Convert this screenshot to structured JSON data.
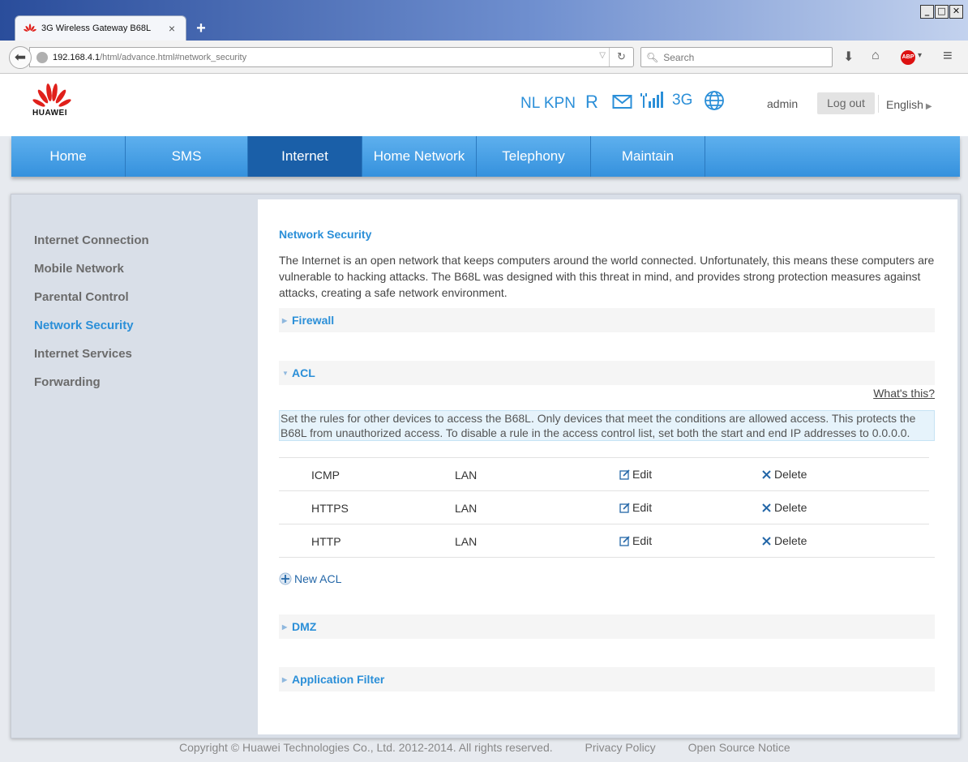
{
  "browser": {
    "tab_title": "3G Wireless Gateway B68L",
    "tab_close": "×",
    "new_tab": "+",
    "url_host": "192.168.4.1",
    "url_path": "/html/advance.html#network_security",
    "search_placeholder": "Search",
    "window_buttons": [
      "_",
      "□",
      "✕"
    ]
  },
  "header": {
    "brand": "HUAWEI",
    "operator": "NL KPN",
    "roaming": "R",
    "network_type": "3G",
    "user": "admin",
    "logout_label": "Log out",
    "language": "English"
  },
  "menu": [
    {
      "label": "Home",
      "active": false
    },
    {
      "label": "SMS",
      "active": false
    },
    {
      "label": "Internet",
      "active": true
    },
    {
      "label": "Home Network",
      "active": false
    },
    {
      "label": "Telephony",
      "active": false
    },
    {
      "label": "Maintain",
      "active": false
    }
  ],
  "sidebar": [
    {
      "label": "Internet Connection",
      "active": false
    },
    {
      "label": "Mobile Network",
      "active": false
    },
    {
      "label": "Parental Control",
      "active": false
    },
    {
      "label": "Network Security",
      "active": true
    },
    {
      "label": "Internet Services",
      "active": false
    },
    {
      "label": "Forwarding",
      "active": false
    }
  ],
  "main": {
    "title": "Network Security",
    "description": "The Internet is an open network that keeps computers around the world connected. Unfortunately, this means these computers are vulnerable to hacking attacks. The B68L was designed with this threat in mind, and provides strong protection measures against attacks, creating a safe network environment.",
    "sections": {
      "firewall": "Firewall",
      "acl": "ACL",
      "dmz": "DMZ",
      "app_filter": "Application Filter"
    },
    "whats_this": "What's this?",
    "acl_info": "Set the rules for other devices to access the B68L. Only devices that meet the conditions are allowed access. This protects the B68L from unauthorized access. To disable a rule in the access control list, set both the start and end IP addresses to 0.0.0.0.",
    "acl_rows": [
      {
        "protocol": "ICMP",
        "interface": "LAN",
        "edit": "Edit",
        "delete": "Delete"
      },
      {
        "protocol": "HTTPS",
        "interface": "LAN",
        "edit": "Edit",
        "delete": "Delete"
      },
      {
        "protocol": "HTTP",
        "interface": "LAN",
        "edit": "Edit",
        "delete": "Delete"
      }
    ],
    "new_acl": "New ACL"
  },
  "footer": {
    "copyright": "Copyright © Huawei Technologies Co., Ltd. 2012-2014. All rights reserved.",
    "privacy": "Privacy Policy",
    "open_source": "Open Source Notice"
  },
  "colors": {
    "accent": "#2b8fd8",
    "menu_active": "#1a5fa8",
    "brand_red": "#e0201b"
  }
}
